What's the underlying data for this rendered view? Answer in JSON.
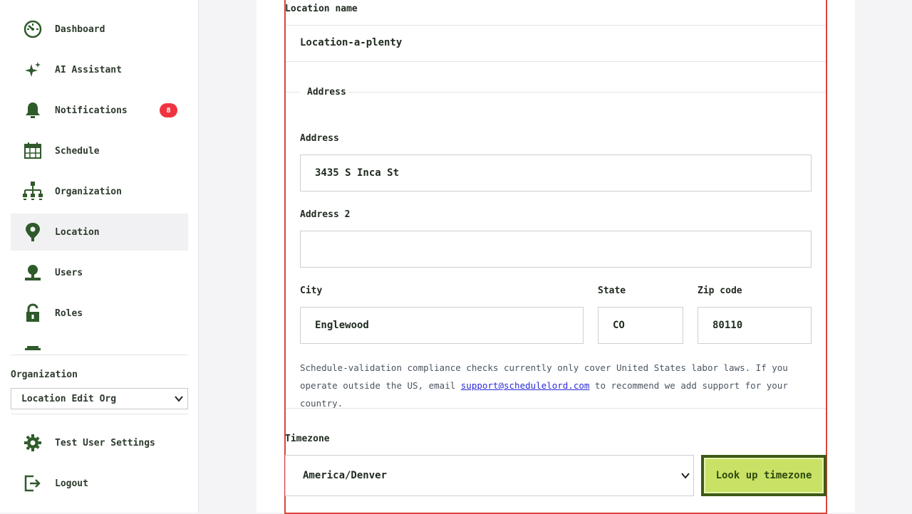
{
  "sidebar": {
    "items": [
      {
        "label": "Dashboard",
        "icon": "dashboard-icon"
      },
      {
        "label": "AI Assistant",
        "icon": "sparkle-icon"
      },
      {
        "label": "Notifications",
        "icon": "bell-icon",
        "badge": "8"
      },
      {
        "label": "Schedule",
        "icon": "calendar-icon"
      },
      {
        "label": "Organization",
        "icon": "org-chart-icon"
      },
      {
        "label": "Location",
        "icon": "location-pin-icon",
        "active": true
      },
      {
        "label": "Users",
        "icon": "user-icon"
      },
      {
        "label": "Roles",
        "icon": "lock-icon"
      }
    ],
    "organization_label": "Organization",
    "organization_value": "Location Edit Org",
    "bottom_items": [
      {
        "label": "Test User Settings",
        "icon": "gear-icon"
      },
      {
        "label": "Logout",
        "icon": "logout-icon"
      }
    ]
  },
  "form": {
    "location_name_label": "Location name",
    "location_name_value": "Location-a-plenty",
    "address_section_label": "Address",
    "address_label": "Address",
    "address_value": "3435 S Inca St",
    "address2_label": "Address 2",
    "address2_value": "",
    "city_label": "City",
    "city_value": "Englewood",
    "state_label": "State",
    "state_value": "CO",
    "zip_label": "Zip code",
    "zip_value": "80110",
    "note_before": "Schedule-validation compliance checks currently only cover United States labor laws. If you operate outside the US, email ",
    "note_email": "support@schedulelord.com",
    "note_after": " to recommend we add support for your country.",
    "timezone_label": "Timezone",
    "timezone_value": "America/Denver",
    "lookup_button": "Look up timezone"
  },
  "colors": {
    "icon_green": "#2f5a2a",
    "badge_red": "#ef3340",
    "focus_red": "#d9453d",
    "button_bg": "#c9e265",
    "button_border": "#3d5a16",
    "link_blue": "#2b2bd6"
  }
}
